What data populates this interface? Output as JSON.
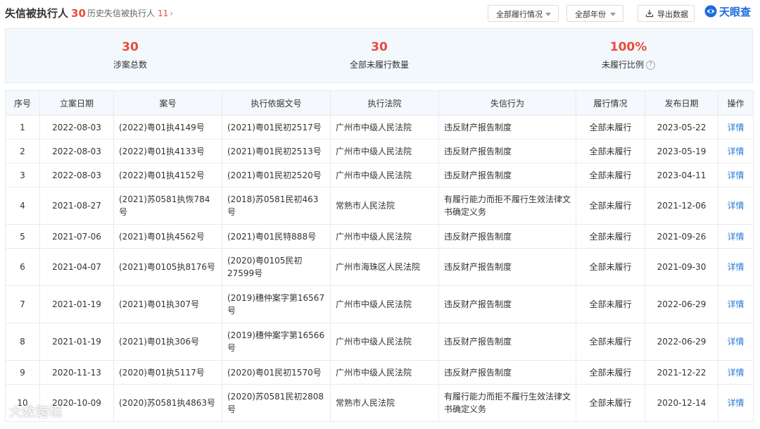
{
  "header": {
    "title": "失信被执行人",
    "title_count": "30",
    "history_label": "历史失信被执行人",
    "history_count": "11",
    "filter_status": "全部履行情况",
    "filter_year": "全部年份",
    "export_label": "导出数据",
    "logo_text": "天眼查"
  },
  "summary": [
    {
      "value": "30",
      "label": "涉案总数"
    },
    {
      "value": "30",
      "label": "全部未履行数量"
    },
    {
      "value": "100%",
      "label": "未履行比例"
    }
  ],
  "table": {
    "columns": [
      "序号",
      "立案日期",
      "案号",
      "执行依据文号",
      "执行法院",
      "失信行为",
      "履行情况",
      "发布日期",
      "操作"
    ],
    "rows": [
      [
        "1",
        "2022-08-03",
        "(2022)粤01执4149号",
        "(2021)粤01民初2517号",
        "广州市中级人民法院",
        "违反财产报告制度",
        "全部未履行",
        "2023-05-22",
        "详情"
      ],
      [
        "2",
        "2022-08-03",
        "(2022)粤01执4133号",
        "(2021)粤01民初2513号",
        "广州市中级人民法院",
        "违反财产报告制度",
        "全部未履行",
        "2023-05-19",
        "详情"
      ],
      [
        "3",
        "2022-08-03",
        "(2022)粤01执4152号",
        "(2021)粤01民初2520号",
        "广州市中级人民法院",
        "违反财产报告制度",
        "全部未履行",
        "2023-04-11",
        "详情"
      ],
      [
        "4",
        "2021-08-27",
        "(2021)苏0581执恢784号",
        "(2018)苏0581民初463号",
        "常熟市人民法院",
        "有履行能力而拒不履行生效法律文书确定义务",
        "全部未履行",
        "2021-12-06",
        "详情"
      ],
      [
        "5",
        "2021-07-06",
        "(2021)粤01执4562号",
        "(2021)粤01民特888号",
        "广州市中级人民法院",
        "违反财产报告制度",
        "全部未履行",
        "2021-09-26",
        "详情"
      ],
      [
        "6",
        "2021-04-07",
        "(2021)粤0105执8176号",
        "(2020)粤0105民初27599号",
        "广州市海珠区人民法院",
        "违反财产报告制度",
        "全部未履行",
        "2021-09-30",
        "详情"
      ],
      [
        "7",
        "2021-01-19",
        "(2021)粤01执307号",
        "(2019)穗仲案字第16567号",
        "广州市中级人民法院",
        "违反财产报告制度",
        "全部未履行",
        "2022-06-29",
        "详情"
      ],
      [
        "8",
        "2021-01-19",
        "(2021)粤01执306号",
        "(2019)穗仲案字第16566号",
        "广州市中级人民法院",
        "违反财产报告制度",
        "全部未履行",
        "2022-06-29",
        "详情"
      ],
      [
        "9",
        "2020-11-13",
        "(2020)粤01执5117号",
        "(2020)粤01民初1570号",
        "广州市中级人民法院",
        "违反财产报告制度",
        "全部未履行",
        "2021-12-22",
        "详情"
      ],
      [
        "10",
        "2020-10-09",
        "(2020)苏0581执4863号",
        "(2020)苏0581民初2808号",
        "常熟市人民法院",
        "有履行能力而拒不履行生效法律文书确定义务",
        "全部未履行",
        "2020-12-14",
        "详情"
      ]
    ]
  },
  "watermark": "大数跨境",
  "colors": {
    "accent_red": "#e94b3c",
    "link_blue": "#2678d8",
    "brand_blue": "#1c6ce0"
  }
}
